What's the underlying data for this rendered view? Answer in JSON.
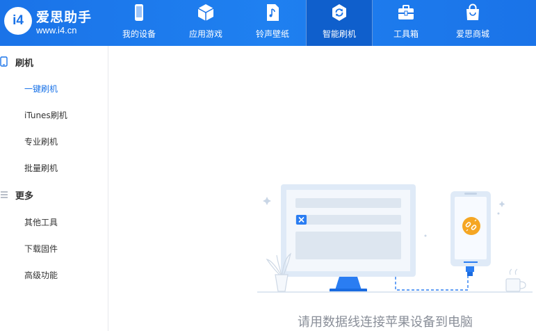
{
  "app": {
    "logo_badge": "i4",
    "logo_name": "爱思助手",
    "logo_url": "www.i4.cn"
  },
  "nav": {
    "items": [
      {
        "label": "我的设备",
        "icon": "phone-icon"
      },
      {
        "label": "应用游戏",
        "icon": "cube-icon"
      },
      {
        "label": "铃声壁纸",
        "icon": "music-file-icon"
      },
      {
        "label": "智能刷机",
        "icon": "refresh-icon"
      },
      {
        "label": "工具箱",
        "icon": "toolbox-icon"
      },
      {
        "label": "爱思商城",
        "icon": "shopping-bag-icon"
      }
    ],
    "active_index": 3
  },
  "sidebar": {
    "groups": [
      {
        "label": "刷机",
        "icon": "phone-outline-icon",
        "items": [
          "一键刷机",
          "iTunes刷机",
          "专业刷机",
          "批量刷机"
        ]
      },
      {
        "label": "更多",
        "icon": "menu-icon",
        "items": [
          "其他工具",
          "下载固件",
          "高级功能"
        ]
      }
    ],
    "active_item": "一键刷机"
  },
  "main": {
    "hint": "请用数据线连接苹果设备到电脑"
  },
  "colors": {
    "brand": "#1a73e8",
    "nav_active": "#0f5fcc",
    "illustration_light": "#dfeaf7",
    "badge_orange": "#f5a623"
  }
}
